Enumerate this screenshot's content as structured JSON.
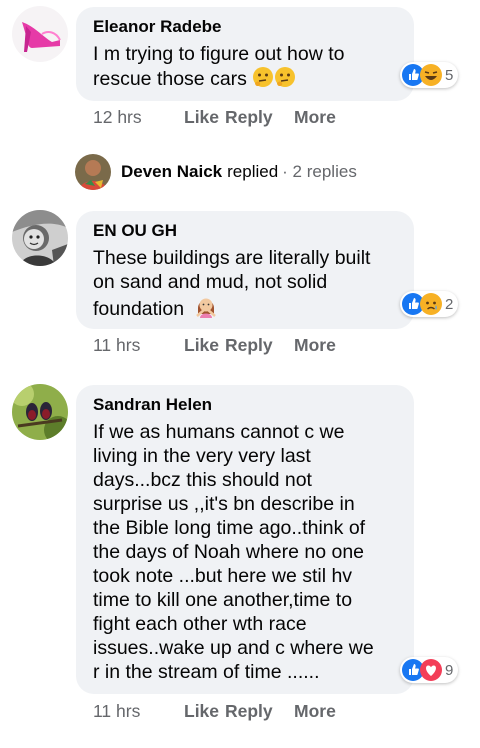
{
  "comments": [
    {
      "author": "Eleanor Radebe",
      "lines": [
        "I m trying to figure out how to",
        "rescue those cars"
      ],
      "reaction_count": "5",
      "reaction_icons": [
        "like-icon",
        "laughing-icon"
      ],
      "time": "12 hrs",
      "like": "Like",
      "reply": "Reply",
      "more": "More",
      "avatar_icon": "pink-high-heel-icon"
    },
    {
      "author": "EN OU GH",
      "lines": [
        "These buildings are literally built",
        "on sand and mud, not solid",
        "foundation"
      ],
      "reaction_count": "2",
      "reaction_icons": [
        "like-icon",
        "sad-icon"
      ],
      "time": "11 hrs",
      "like": "Like",
      "reply": "Reply",
      "more": "More",
      "avatar_icon": "bw-child-photo-icon"
    },
    {
      "author": "Sandran Helen",
      "lines": [
        "If we as humans cannot c we",
        "living in the very very last",
        "days...bcz this should not",
        "surprise us ,,it's bn describe in",
        "the Bible long time ago..think of",
        "the days of Noah where no one",
        "took note ...but here we stil hv",
        "time to kill one another,time to",
        "fight each other wth race",
        "issues..wake up and c where we",
        "r in the stream of time ......"
      ],
      "reaction_count": "9",
      "reaction_icons": [
        "like-icon",
        "love-icon"
      ],
      "time": "11 hrs",
      "like": "Like",
      "reply": "Reply",
      "more": "More",
      "avatar_icon": "birds-photo-icon"
    }
  ],
  "reply_summary": {
    "name": "Deven Naick",
    "verb": "replied",
    "count": "· 2 replies"
  },
  "colors": {
    "bubble": "#f0f2f5",
    "meta": "#65676b",
    "like_blue": "#1877f2",
    "love_red": "#f33e58",
    "haha_yellow": "#f7b125"
  }
}
